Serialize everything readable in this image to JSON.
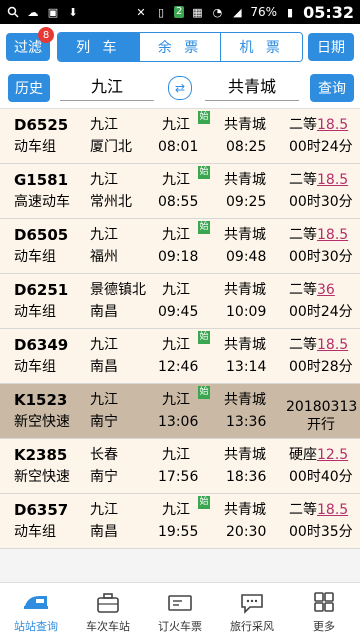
{
  "statusbar": {
    "notification_count": "2",
    "battery": "76%",
    "time": "05:32"
  },
  "topbar": {
    "filter_label": "过滤",
    "filter_badge": "8",
    "segments": [
      "列 车",
      "余 票",
      "机 票"
    ],
    "date_label": "日期"
  },
  "searchbar": {
    "history_label": "历史",
    "from_station": "九江",
    "to_station": "共青城",
    "query_label": "查询"
  },
  "trains": [
    {
      "no": "D6525",
      "type": "动车组",
      "from": "九江",
      "board": "厦门北",
      "depart_station": "九江",
      "depart_time": "08:01",
      "start_tag": "始",
      "arrive_station": "共青城",
      "arrive_time": "08:25",
      "seat": "二等",
      "price": "18.5",
      "duration": "00时24分"
    },
    {
      "no": "G1581",
      "type": "高速动车",
      "from": "九江",
      "board": "常州北",
      "depart_station": "九江",
      "depart_time": "08:55",
      "start_tag": "始",
      "arrive_station": "共青城",
      "arrive_time": "09:25",
      "seat": "二等",
      "price": "18.5",
      "duration": "00时30分"
    },
    {
      "no": "D6505",
      "type": "动车组",
      "from": "九江",
      "board": "福州",
      "depart_station": "九江",
      "depart_time": "09:18",
      "start_tag": "始",
      "arrive_station": "共青城",
      "arrive_time": "09:48",
      "seat": "二等",
      "price": "18.5",
      "duration": "00时30分"
    },
    {
      "no": "D6251",
      "type": "动车组",
      "from": "景德镇北",
      "board": "南昌",
      "depart_station": "九江",
      "depart_time": "09:45",
      "start_tag": "",
      "arrive_station": "共青城",
      "arrive_time": "10:09",
      "seat": "二等",
      "price": "36",
      "duration": "00时24分"
    },
    {
      "no": "D6349",
      "type": "动车组",
      "from": "九江",
      "board": "南昌",
      "depart_station": "九江",
      "depart_time": "12:46",
      "start_tag": "始",
      "arrive_station": "共青城",
      "arrive_time": "13:14",
      "seat": "二等",
      "price": "18.5",
      "duration": "00时28分"
    },
    {
      "no": "K1523",
      "type": "新空快速",
      "from": "九江",
      "board": "南宁",
      "depart_station": "九江",
      "depart_time": "13:06",
      "start_tag": "始",
      "arrive_station": "共青城",
      "arrive_time": "13:36",
      "status_line1": "20180313",
      "status_line2": "开行"
    },
    {
      "no": "K2385",
      "type": "新空快速",
      "from": "长春",
      "board": "南宁",
      "depart_station": "九江",
      "depart_time": "17:56",
      "start_tag": "",
      "arrive_station": "共青城",
      "arrive_time": "18:36",
      "seat": "硬座",
      "price": "12.5",
      "duration": "00时40分"
    },
    {
      "no": "D6357",
      "type": "动车组",
      "from": "九江",
      "board": "南昌",
      "depart_station": "九江",
      "depart_time": "19:55",
      "start_tag": "始",
      "arrive_station": "共青城",
      "arrive_time": "20:30",
      "seat": "二等",
      "price": "18.5",
      "duration": "00时35分"
    }
  ],
  "tabs": [
    {
      "label": "站站查询",
      "icon": "train-icon",
      "active": true
    },
    {
      "label": "车次车站",
      "icon": "suitcase-icon",
      "active": false
    },
    {
      "label": "订火车票",
      "icon": "ticket-icon",
      "active": false
    },
    {
      "label": "旅行采风",
      "icon": "chat-bubble-icon",
      "active": false
    },
    {
      "label": "更多",
      "icon": "grid-icon",
      "active": false
    }
  ]
}
